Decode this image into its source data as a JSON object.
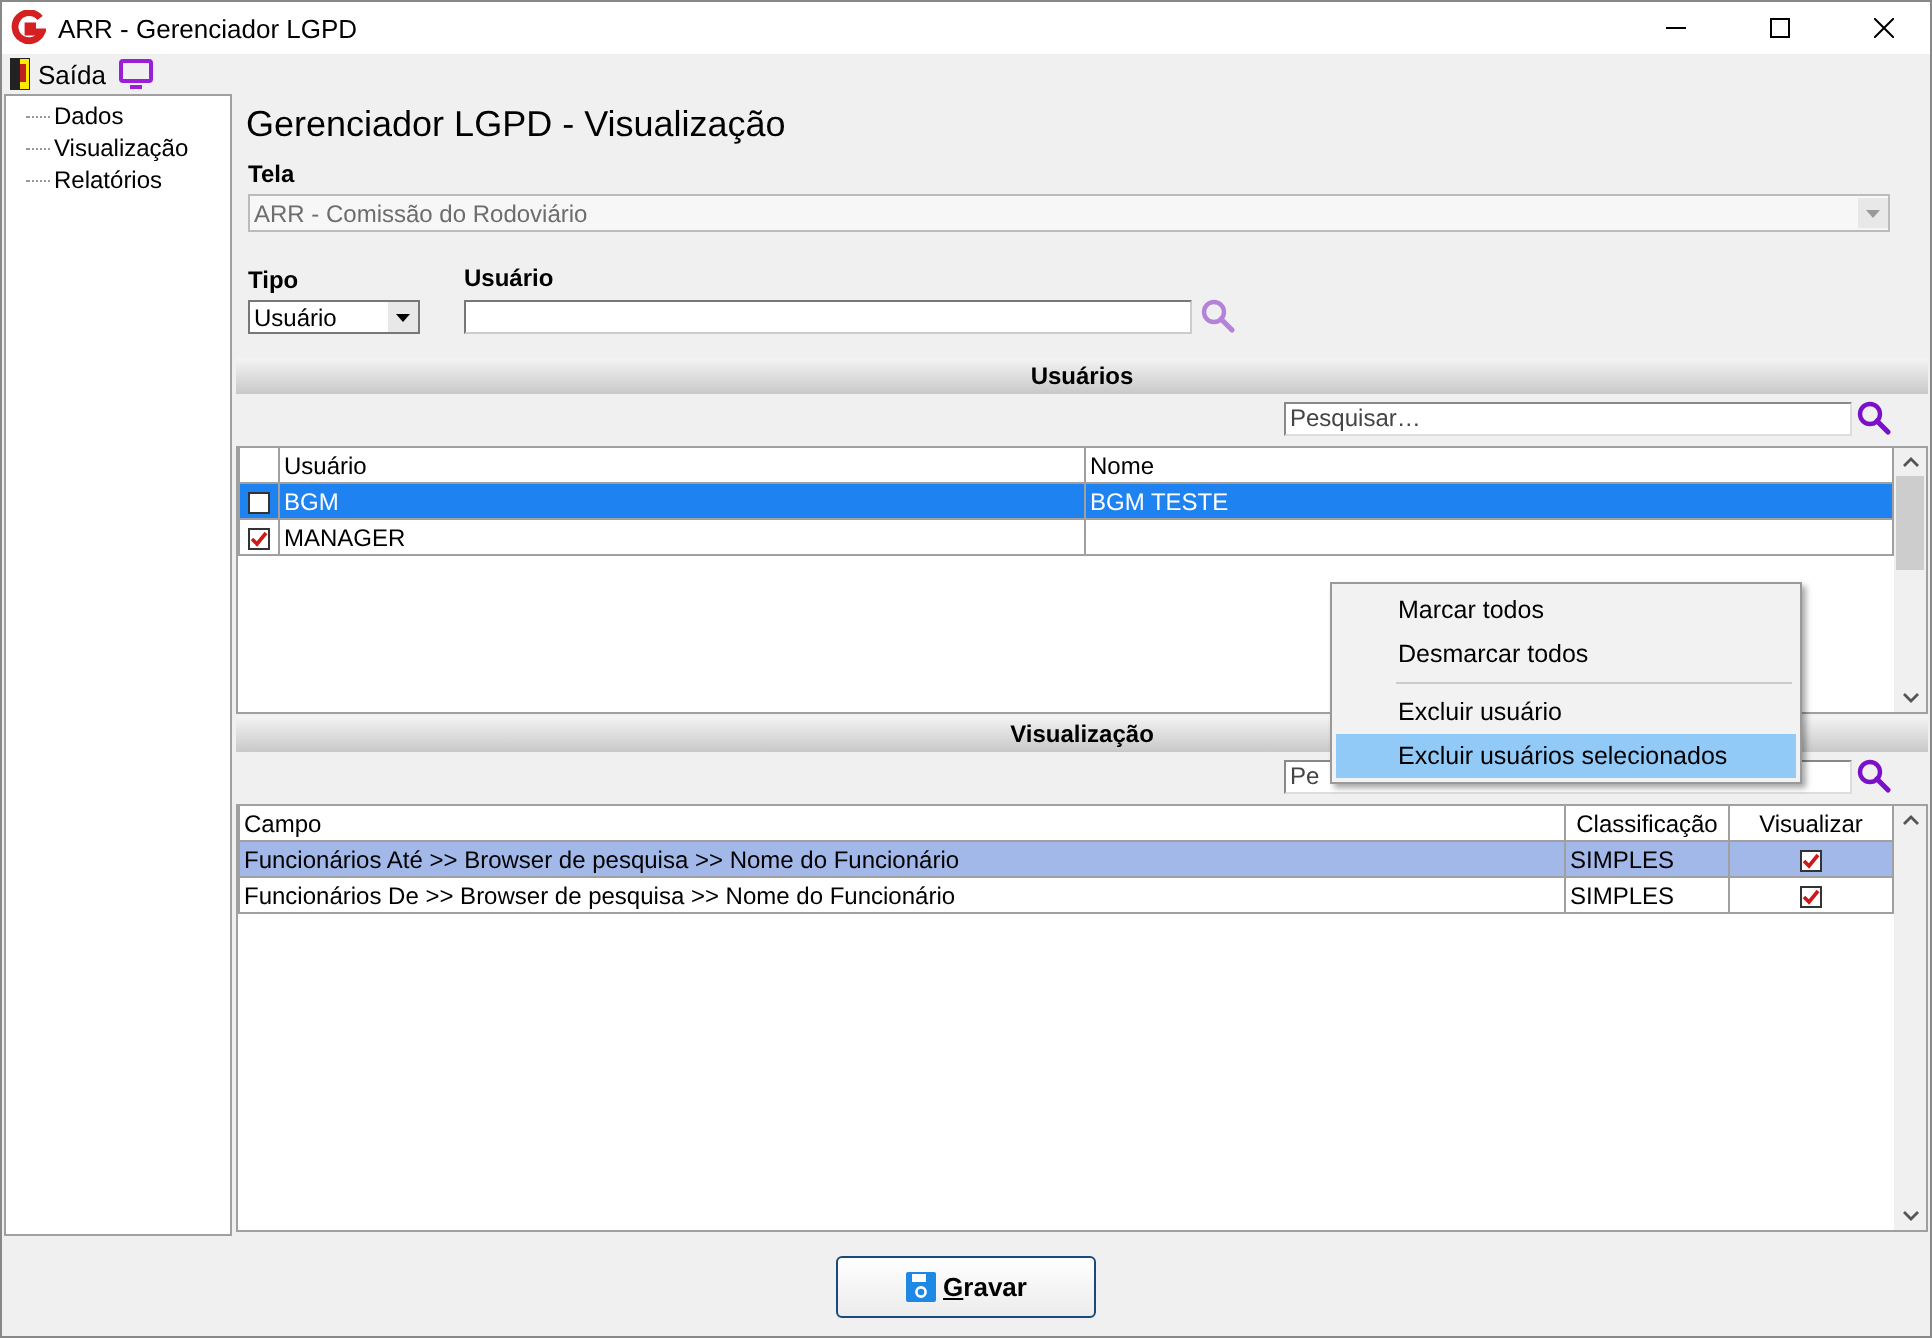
{
  "window": {
    "title": "ARR - Gerenciador LGPD"
  },
  "toolbar": {
    "exit_label": "Saída"
  },
  "sidebar": {
    "items": [
      {
        "label": "Dados"
      },
      {
        "label": "Visualização"
      },
      {
        "label": "Relatórios"
      }
    ]
  },
  "heading": "Gerenciador LGPD - Visualização",
  "tela": {
    "label": "Tela",
    "value": "ARR - Comissão do Rodoviário",
    "disabled": true
  },
  "tipo": {
    "label": "Tipo",
    "value": "Usuário"
  },
  "usuario": {
    "label": "Usuário"
  },
  "users_section": {
    "title": "Usuários",
    "search_placeholder": "Pesquisar…",
    "columns": [
      "Usuário",
      "Nome"
    ],
    "rows": [
      {
        "checked": false,
        "selected": true,
        "cells": [
          "BGM",
          "BGM TESTE"
        ]
      },
      {
        "checked": true,
        "selected": false,
        "cells": [
          "MANAGER"
        ]
      }
    ]
  },
  "context_menu": {
    "items": [
      {
        "kind": "item",
        "label": "Marcar todos",
        "selected": false
      },
      {
        "kind": "item",
        "label": "Desmarcar todos",
        "selected": false
      },
      {
        "kind": "separator"
      },
      {
        "kind": "item",
        "label": "Excluir usuário",
        "selected": false
      },
      {
        "kind": "item",
        "label": "Excluir usuários selecionados",
        "selected": true
      }
    ]
  },
  "view_section": {
    "title": "Visualização",
    "search_placeholder": "Pe",
    "columns": [
      "Campo",
      "Classificação",
      "Visualizar"
    ],
    "rows": [
      {
        "selected": true,
        "campo": "Funcionários Até >> Browser de pesquisa >> Nome do Funcionário",
        "classificacao": "SIMPLES",
        "visualizar": true
      },
      {
        "selected": false,
        "campo": "Funcionários De >> Browser de pesquisa >> Nome do Funcionário",
        "classificacao": "SIMPLES",
        "visualizar": true
      }
    ]
  },
  "buttons": [
    {
      "label": "Gravar"
    }
  ]
}
